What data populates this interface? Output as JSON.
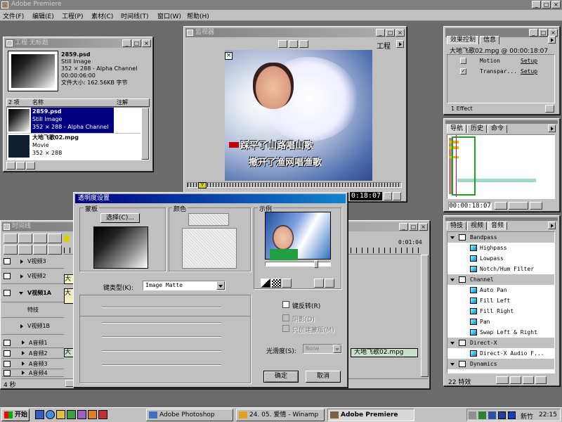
{
  "app": {
    "title": "Adobe Premiere"
  },
  "menu": [
    "文件(F)",
    "编辑(E)",
    "工程(P)",
    "素材(C)",
    "时间线(T)",
    "窗口(W)",
    "帮助(H)"
  ],
  "project": {
    "title": "工程 无标题",
    "preview": {
      "name": "2859.psd",
      "type": "Still Image",
      "dims": "352 × 288 - Alpha Channel",
      "duration": "00:00:06:00",
      "size": "文件大小: 162.56KB 字节"
    },
    "count": "2 项",
    "col_name": "名称",
    "col_note": "注解",
    "items": [
      {
        "name": "2859.psd",
        "type": "Still Image",
        "dims": "352 × 288 - Alpha Channel"
      },
      {
        "name": "大地飞歌02.mpg",
        "type": "Movie",
        "dims": "352 × 288"
      }
    ]
  },
  "monitor": {
    "title": "监视器",
    "mode": "工程",
    "subtitle1": "踩平了山路唱山歌",
    "subtitle2": "撒开了渔网唱渔歌",
    "timecode": "0:18:07"
  },
  "effect_controls": {
    "tabs": [
      "效果控制",
      "信息"
    ],
    "clip": "大地飞歌02.mpg @ 00:00:18:07",
    "effects": [
      {
        "name": "Motion",
        "setup": "Setup"
      },
      {
        "name": "Transpar...",
        "setup": "Setup"
      }
    ],
    "count": "1 Effect"
  },
  "navigator": {
    "tabs": [
      "导航",
      "历史",
      "命令"
    ],
    "timecode": "00:00:18:07"
  },
  "effects_lib": {
    "tabs": [
      "特技",
      "视频",
      "音频"
    ],
    "rows": [
      {
        "kind": "folder",
        "label": "Bandpass"
      },
      {
        "kind": "item",
        "label": "Highpass"
      },
      {
        "kind": "item",
        "label": "Lowpass"
      },
      {
        "kind": "item",
        "label": "Notch/Hum Filter"
      },
      {
        "kind": "folder",
        "label": "Channel"
      },
      {
        "kind": "item",
        "label": "Auto Pan"
      },
      {
        "kind": "item",
        "label": "Fill Left"
      },
      {
        "kind": "item",
        "label": "Fill Right"
      },
      {
        "kind": "item",
        "label": "Pan"
      },
      {
        "kind": "item",
        "label": "Swap Left & Right"
      },
      {
        "kind": "folder",
        "label": "Direct-X"
      },
      {
        "kind": "item",
        "label": "Direct-X Audio F..."
      },
      {
        "kind": "folder",
        "label": "Dynamics"
      }
    ],
    "count": "22 特效"
  },
  "timeline": {
    "title": "时间线",
    "time_mark": "0:01:04",
    "tracks": [
      "V视频3",
      "V视频2",
      "V视频1A",
      "特技",
      "V视频1B",
      "A音频1",
      "A音频2",
      "A音频3",
      "A音频4"
    ],
    "zoom": "4 秒",
    "clip_label": "大地飞歌02.mpg",
    "clip_short": "大"
  },
  "dialog": {
    "title": "透明度设置",
    "mask_label": "蒙板",
    "select_btn": "选择(C)...",
    "color_label": "颜色",
    "sample_label": "示例",
    "keytype_label": "键类型(K):",
    "keytype_value": "Image Matte",
    "reverse_label": "键反转(R)",
    "shadow_label": "阴影(D)",
    "mask_only_label": "只创建蒙版(M)",
    "smooth_label": "光滑度(S):",
    "smooth_value": "None",
    "ok": "确定",
    "cancel": "取消"
  },
  "taskbar": {
    "start": "开始",
    "tasks": [
      "Adobe Photoshop",
      "24. 05. 爱情 - Winamp",
      "Adobe Premiere"
    ],
    "ime": "新竹",
    "time": "22:15"
  }
}
